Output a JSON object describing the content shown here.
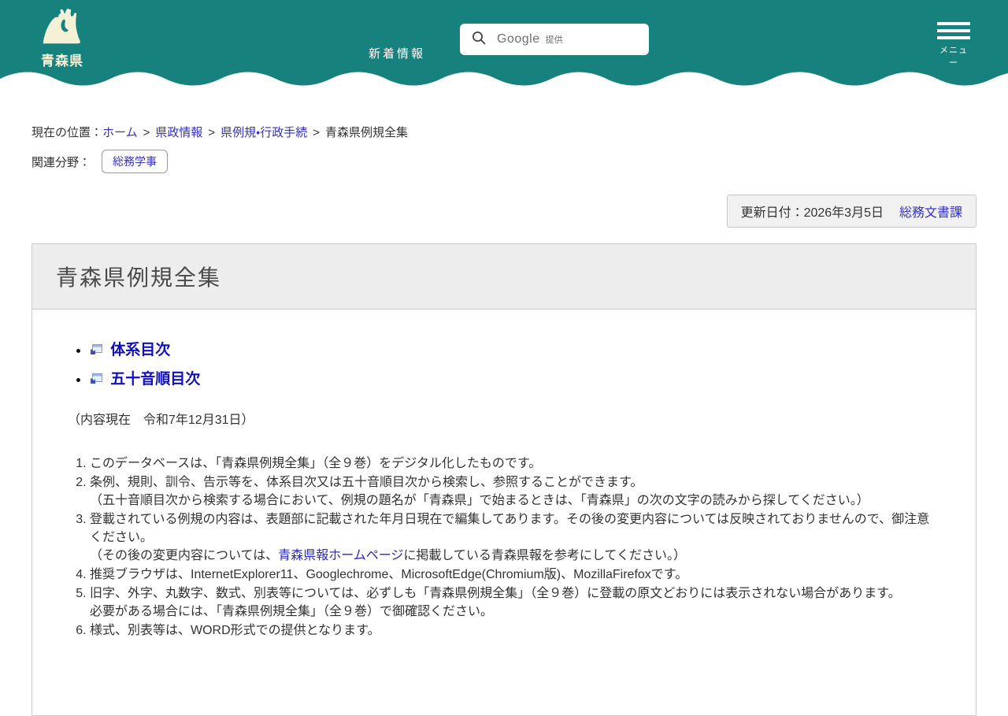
{
  "theme": {
    "header_teal": "#17827D",
    "logo_cream": "#F5F1D7",
    "link_blue": "#3232C8",
    "toc_link_blue": "#0F0FBE",
    "body_text": "#333333",
    "box_gray": "#F1F1F1",
    "border_gray": "#CCCCCC"
  },
  "header": {
    "logo_text": "青森県",
    "new_info_label": "新着情報",
    "search": {
      "provider": "Google",
      "provided_by": "提供"
    },
    "menu_label": "メニュー"
  },
  "breadcrumb": {
    "prefix": "現在の位置：",
    "separator": ">",
    "items": [
      {
        "label": "ホーム"
      },
      {
        "label": "県政情報"
      },
      {
        "label": "県例規・行政手続"
      },
      {
        "label": "青森県例規全集"
      }
    ]
  },
  "related": {
    "label": "関連分野：",
    "tag": "総務学事"
  },
  "meta": {
    "updated_label": "更新日付：2026年3月5日",
    "department": "総務文書課"
  },
  "page": {
    "title": "青森県例規全集"
  },
  "content": {
    "toc_links": [
      {
        "label": "体系目次"
      },
      {
        "label": "五十音順目次"
      }
    ],
    "current_as_of": "（内容現在　令和7年12月31日）",
    "notes": [
      {
        "text": "このデータベースは、「青森県例規全集」（全９巻）をデジタル化したものです。"
      },
      {
        "text": "条例、規則、訓令、告示等を、体系目次又は五十音順目次から検索し、参照することができます。",
        "note": "（五十音順目次から検索する場合において、例規の題名が「青森県」で始まるときは、「青森県」の次の文字の読みから探してください。）"
      },
      {
        "text": "登載されている例規の内容は、表題部に記載された年月日現在で編集してあります。その後の変更内容については反映されておりませんので、御注意ください。",
        "note_pre": "（その後の変更内容については、",
        "note_link": "青森県報ホームページ",
        "note_post": "に掲載している青森県報を参考にしてください。）"
      },
      {
        "text": "推奨ブラウザは、InternetExplorer11、Googlechrome、MicrosoftEdge(Chromium版)、MozillaFirefoxです。"
      },
      {
        "text": "旧字、外字、丸数字、数式、別表等については、必ずしも「青森県例規全集」（全９巻）に登載の原文どおりには表示されない場合があります。",
        "note": "必要がある場合には、「青森県例規全集」（全９巻）で御確認ください。"
      },
      {
        "text": "様式、別表等は、WORD形式での提供となります。"
      }
    ]
  }
}
